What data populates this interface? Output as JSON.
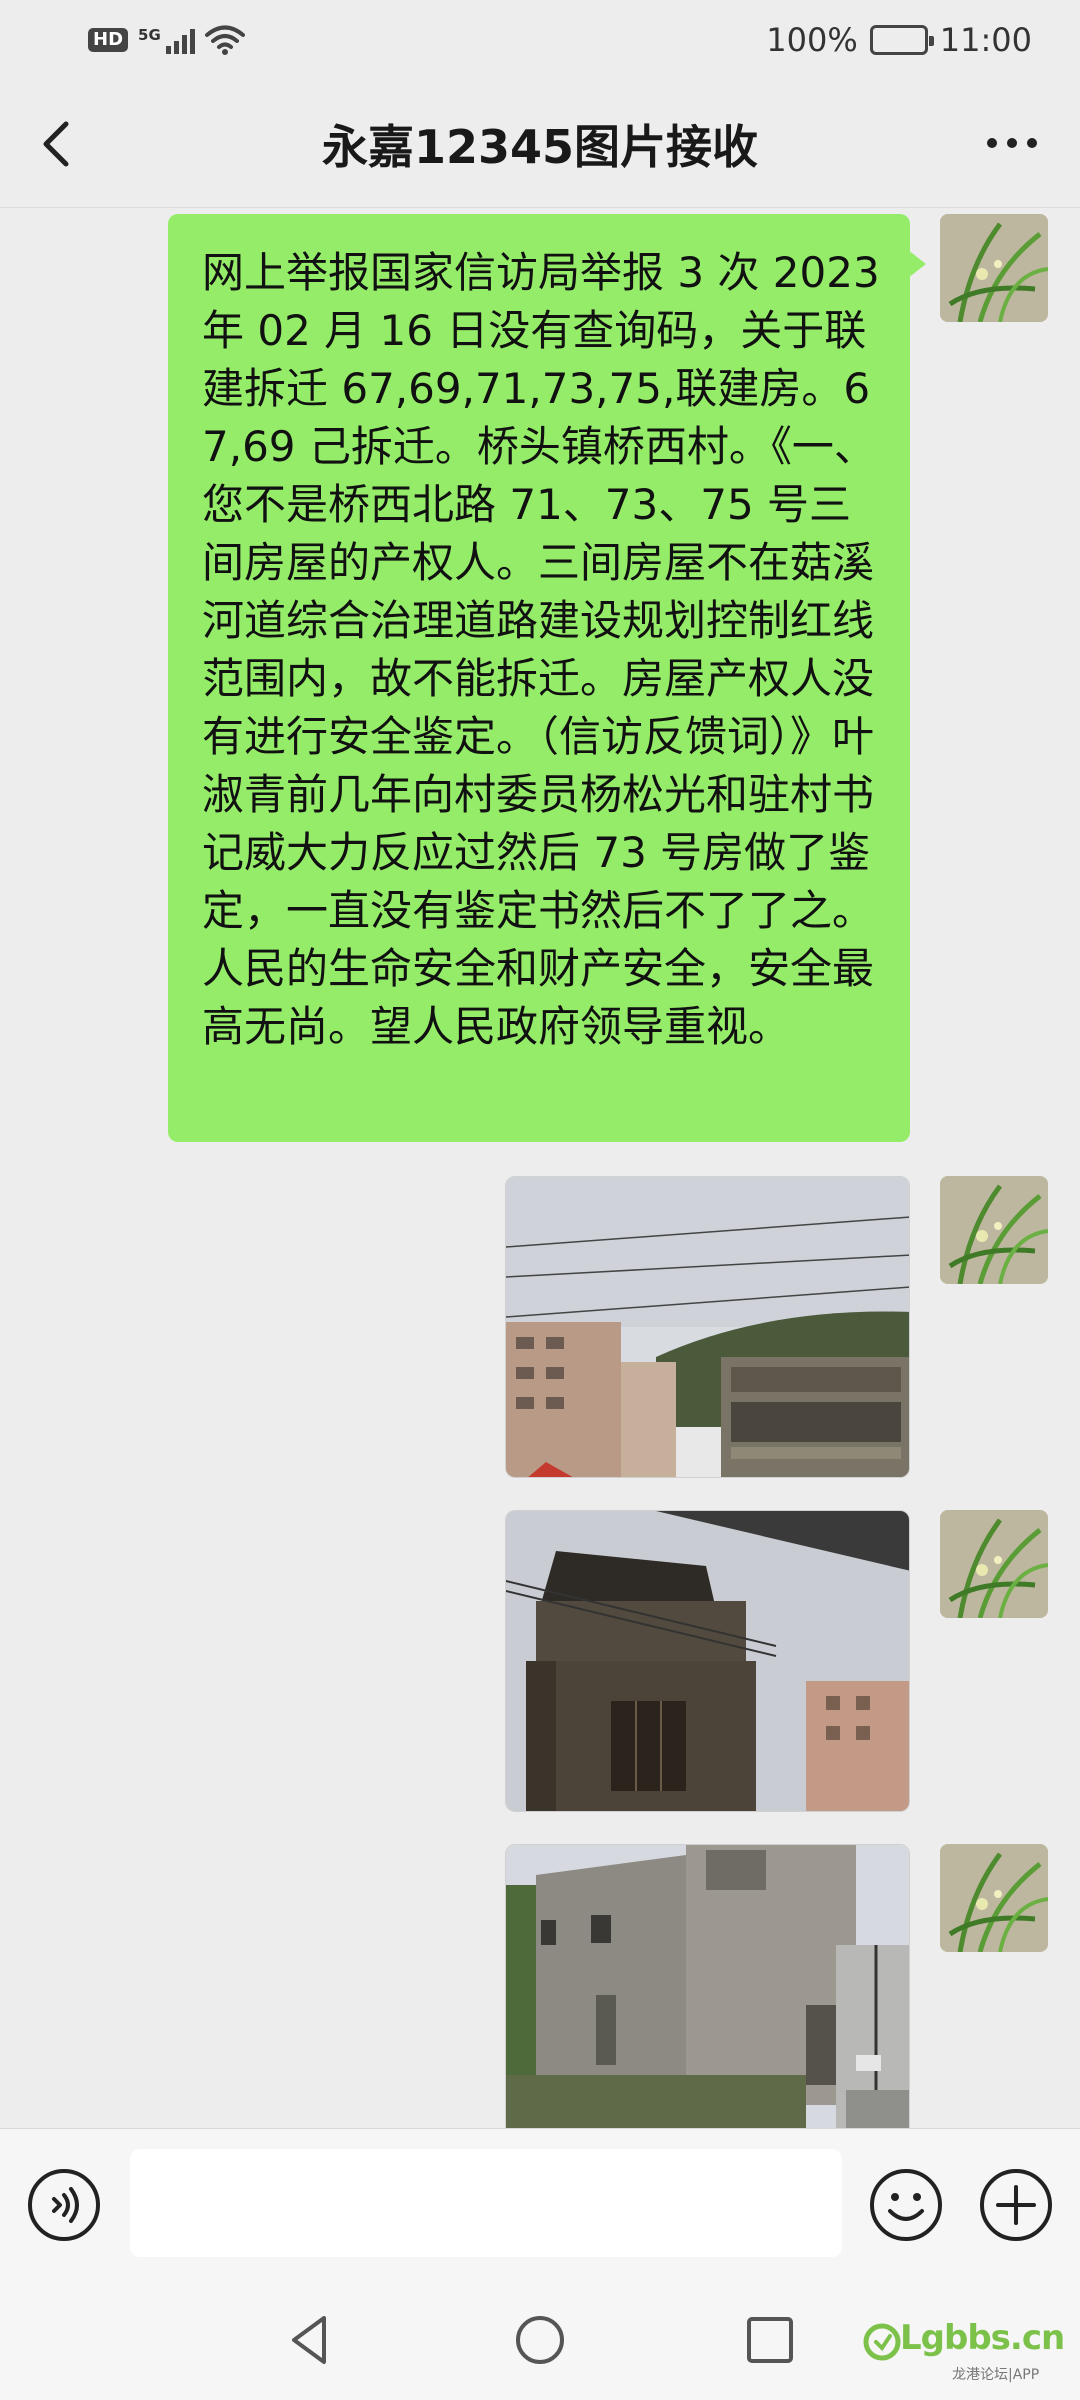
{
  "status_bar": {
    "hd": "HD",
    "network": "5G",
    "battery": "100%",
    "time": "11:00"
  },
  "header": {
    "title": "永嘉12345图片接收",
    "back_icon": "chevron-left-icon",
    "more_icon": "more-horizontal-icon"
  },
  "message": {
    "text": "网上举报国家信访局举报 3 次 2023 年 02 月 16 日没有查询码，关于联建拆迁 67,69,71,73,75,联建房。67,69 己拆迁。桥头镇桥西村。《一、您不是桥西北路 71、73、75 号三间房屋的产权人。三间房屋不在菇溪河道综合治理道路建设规划控制红线范围内，故不能拆迁。房屋产权人没有进行安全鉴定。（信访反馈词）》叶淑青前几年向村委员杨松光和驻村书记威大力反应过然后 73 号房做了鉴定，一直没有鉴定书然后不了了之。人民的生命安全和财产安全，安全最高无尚。望人民政府领导重视。"
  },
  "photos": [
    {
      "name": "photo-buildings-street"
    },
    {
      "name": "photo-old-house"
    },
    {
      "name": "photo-gray-wall"
    }
  ],
  "input": {
    "value": "",
    "voice_icon": "voice-icon",
    "emoji_icon": "emoji-icon",
    "plus_icon": "plus-icon"
  },
  "watermark": {
    "main": "Lgbbs.cn",
    "sub": "龙港论坛|APP"
  },
  "colors": {
    "bubble": "#95ec69",
    "background": "#ededed",
    "watermark": "#7cc24a"
  }
}
